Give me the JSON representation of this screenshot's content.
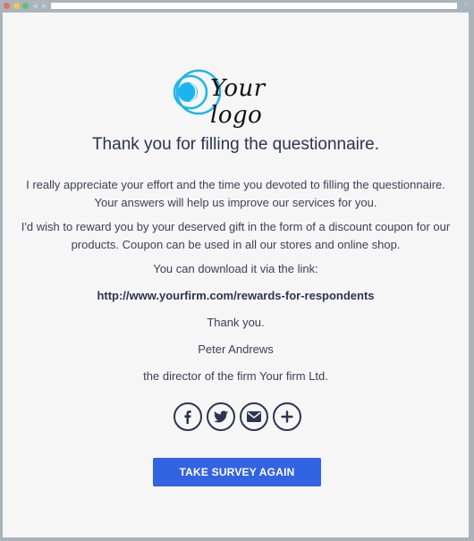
{
  "browser": {
    "address_text": "",
    "window_controls": [
      "close",
      "minimize",
      "maximize"
    ],
    "nav_icons": [
      "back-arrow-icon",
      "forward-arrow-icon"
    ]
  },
  "logo": {
    "text": "Your logo",
    "accent_color": "#1fb3ee"
  },
  "content": {
    "heading": "Thank you for filling the questionnaire.",
    "paragraph1": "I really appreciate your effort and the time you devoted to filling the questionnaire. Your answers will help us improve our services for you.",
    "paragraph2": "I'd wish to reward you by your deserved gift in the form of a discount coupon for our products. Coupon can be used in all our stores and online shop.",
    "download_text": "You can download it via the link:",
    "link": "http://www.yourfirm.com/rewards-for-respondents",
    "thanks": "Thank you.",
    "signer_name": "Peter Andrews",
    "signer_title": "the director of the firm Your firm Ltd."
  },
  "social": [
    {
      "name": "facebook",
      "icon": "facebook-icon",
      "glyph": "f"
    },
    {
      "name": "twitter",
      "icon": "twitter-icon"
    },
    {
      "name": "email",
      "icon": "envelope-icon"
    },
    {
      "name": "more",
      "icon": "plus-icon",
      "glyph": "+"
    }
  ],
  "button": {
    "label": "TAKE SURVEY AGAIN",
    "color": "#3263e2"
  }
}
